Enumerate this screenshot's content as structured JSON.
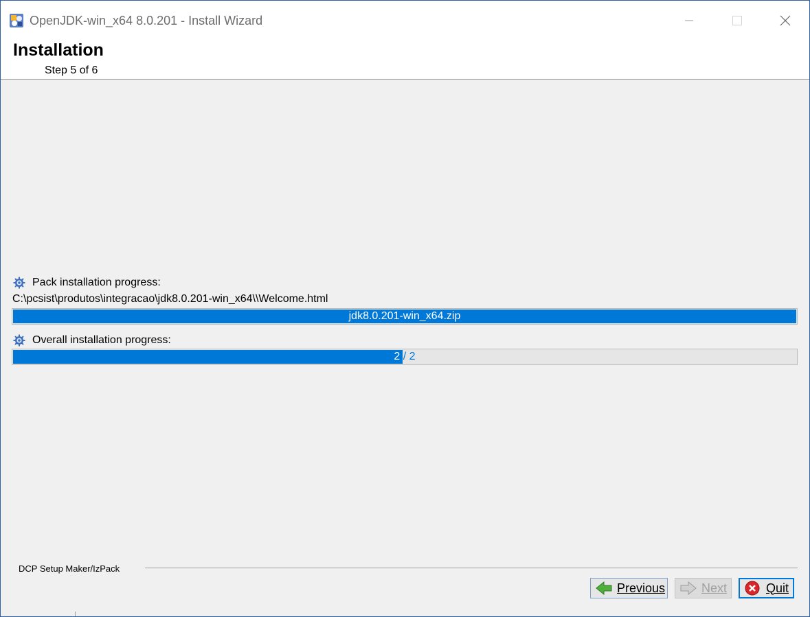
{
  "window": {
    "title": "OpenJDK-win_x64 8.0.201 - Install Wizard"
  },
  "header": {
    "heading": "Installation",
    "step": "Step 5 of 6"
  },
  "pack_progress": {
    "label": "Pack installation progress:",
    "current_file": "C:\\pcsist\\produtos\\integracao\\jdk8.0.201-win_x64\\\\Welcome.html",
    "bar_text": "jdk8.0.201-win_x64.zip",
    "fraction": 1.0
  },
  "overall_progress": {
    "label": "Overall installation progress:",
    "bar_text": "2 / 2",
    "fraction": 0.497
  },
  "footer": {
    "brand": "DCP Setup Maker/IzPack"
  },
  "buttons": {
    "previous": "Previous",
    "next": "Next",
    "quit": "Quit"
  },
  "colors": {
    "accent": "#0078d7",
    "background": "#f0f0f0"
  },
  "icons": {
    "app": "app-installer-icon",
    "gear": "gear-icon",
    "previous": "arrow-left-icon",
    "next": "arrow-right-icon",
    "quit": "stop-x-icon"
  }
}
